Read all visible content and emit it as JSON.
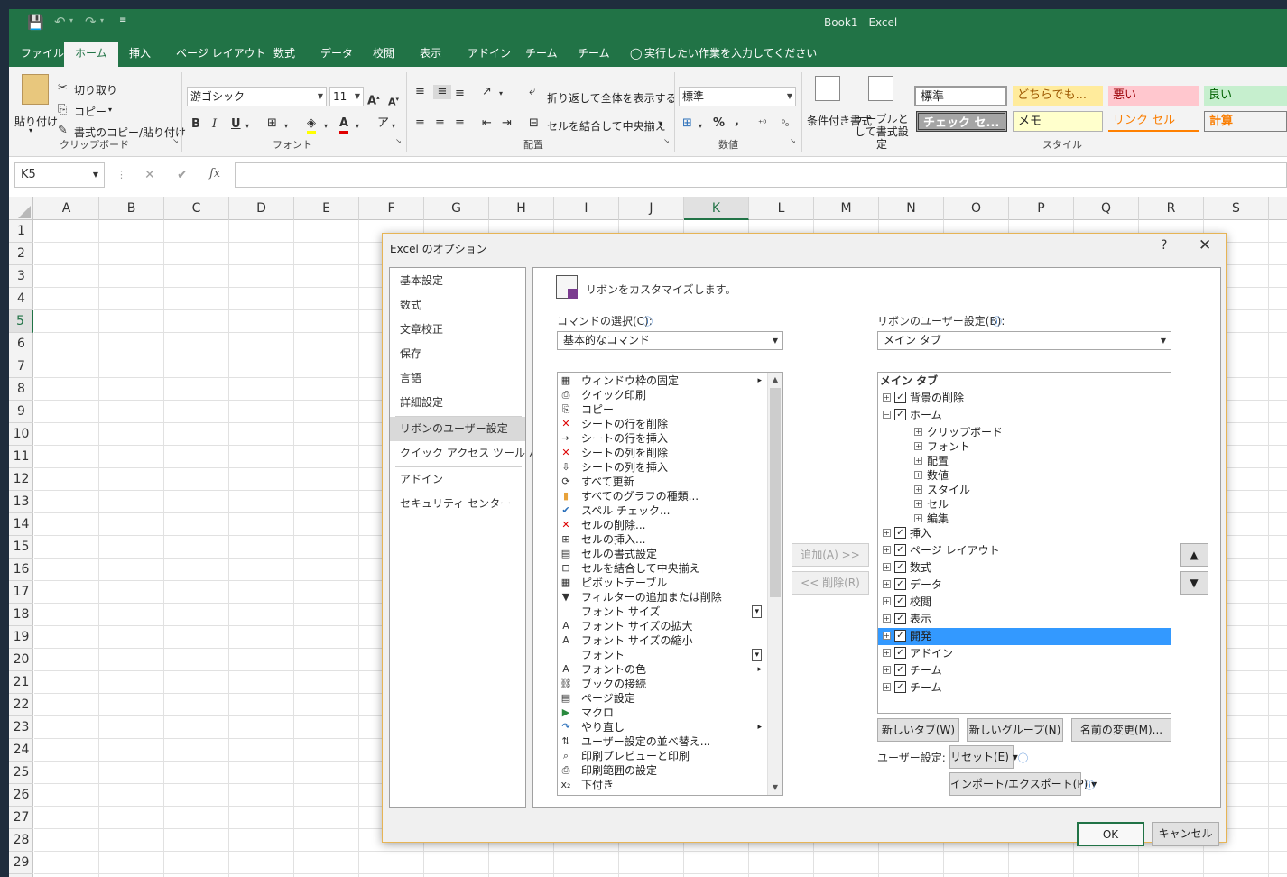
{
  "titlebar": {
    "title": "Book1  -  Excel"
  },
  "tabs": [
    "ファイル",
    "ホーム",
    "挿入",
    "ページ レイアウト",
    "数式",
    "データ",
    "校閲",
    "表示",
    "アドイン",
    "チーム",
    "チーム"
  ],
  "tell_me": "実行したい作業を入力してください",
  "ribbon": {
    "clipboard": {
      "paste": "貼り付け",
      "cut": "切り取り",
      "copy": "コピー",
      "format_painter": "書式のコピー/貼り付け",
      "label": "クリップボード"
    },
    "font": {
      "name": "游ゴシック",
      "size": "11",
      "bold": "B",
      "italic": "I",
      "underline": "U",
      "label": "フォント"
    },
    "alignment": {
      "wrap": "折り返して全体を表示する",
      "merge": "セルを結合して中央揃え",
      "label": "配置"
    },
    "number": {
      "format": "標準",
      "percent": "%",
      "comma": ",",
      "label": "数値"
    },
    "styles": {
      "cond_format": "条件付き書式",
      "format_table": "テーブルとして書式設定",
      "label": "スタイル",
      "cells": [
        "標準",
        "どちらでも...",
        "悪い",
        "良い",
        "チェック セ...",
        "メモ",
        "リンク セル",
        "計算"
      ]
    }
  },
  "formula": {
    "namebox": "K5",
    "cancel": "✕",
    "enter": "✔",
    "fx": "fx"
  },
  "columns": [
    "A",
    "B",
    "C",
    "D",
    "E",
    "F",
    "G",
    "H",
    "I",
    "J",
    "K",
    "L",
    "M",
    "N",
    "O",
    "P",
    "Q",
    "R",
    "S"
  ],
  "selected_column": "K",
  "rows": [
    "1",
    "2",
    "3",
    "4",
    "5",
    "6",
    "7",
    "8",
    "9",
    "10",
    "11",
    "12",
    "13",
    "14",
    "15",
    "16",
    "17",
    "18",
    "19",
    "20",
    "21",
    "22",
    "23",
    "24",
    "25",
    "26",
    "27",
    "28",
    "29"
  ],
  "selected_row": "5",
  "dialog": {
    "title": "Excel のオプション",
    "help": "?",
    "close": "✕",
    "nav": [
      "基本設定",
      "数式",
      "文章校正",
      "保存",
      "言語",
      "詳細設定",
      "リボンのユーザー設定",
      "クイック アクセス ツール バー",
      "アドイン",
      "セキュリティ センター"
    ],
    "nav_selected": "リボンのユーザー設定",
    "heading": "リボンをカスタマイズします。",
    "choose_label": "コマンドの選択(C):",
    "choose_value": "基本的なコマンド",
    "customize_label": "リボンのユーザー設定(B):",
    "customize_value": "メイン タブ",
    "commands": [
      {
        "label": "ウィンドウ枠の固定",
        "icon": "freeze-panes-icon",
        "extra": "▸"
      },
      {
        "label": "クイック印刷",
        "icon": "quick-print-icon",
        "extra": ""
      },
      {
        "label": "コピー",
        "icon": "copy-icon",
        "extra": ""
      },
      {
        "label": "シートの行を削除",
        "icon": "delete-rows-icon",
        "extra": ""
      },
      {
        "label": "シートの行を挿入",
        "icon": "insert-rows-icon",
        "extra": ""
      },
      {
        "label": "シートの列を削除",
        "icon": "delete-columns-icon",
        "extra": ""
      },
      {
        "label": "シートの列を挿入",
        "icon": "insert-columns-icon",
        "extra": ""
      },
      {
        "label": "すべて更新",
        "icon": "refresh-all-icon",
        "extra": ""
      },
      {
        "label": "すべてのグラフの種類...",
        "icon": "chart-types-icon",
        "extra": ""
      },
      {
        "label": "スペル チェック...",
        "icon": "spell-check-icon",
        "extra": ""
      },
      {
        "label": "セルの削除...",
        "icon": "delete-cells-icon",
        "extra": ""
      },
      {
        "label": "セルの挿入...",
        "icon": "insert-cells-icon",
        "extra": ""
      },
      {
        "label": "セルの書式設定",
        "icon": "format-cells-icon",
        "extra": ""
      },
      {
        "label": "セルを結合して中央揃え",
        "icon": "merge-center-icon",
        "extra": ""
      },
      {
        "label": "ピボットテーブル",
        "icon": "pivot-table-icon",
        "extra": ""
      },
      {
        "label": "フィルターの追加または削除",
        "icon": "filter-icon",
        "extra": ""
      },
      {
        "label": "フォント サイズ",
        "icon": "font-size-icon",
        "extra": "▾"
      },
      {
        "label": "フォント サイズの拡大",
        "icon": "font-grow-icon",
        "extra": ""
      },
      {
        "label": "フォント サイズの縮小",
        "icon": "font-shrink-icon",
        "extra": ""
      },
      {
        "label": "フォント",
        "icon": "font-icon",
        "extra": "▾"
      },
      {
        "label": "フォントの色",
        "icon": "font-color-icon",
        "extra": "▸"
      },
      {
        "label": "ブックの接続",
        "icon": "connections-icon",
        "extra": ""
      },
      {
        "label": "ページ設定",
        "icon": "page-setup-icon",
        "extra": ""
      },
      {
        "label": "マクロ",
        "icon": "macro-icon",
        "extra": ""
      },
      {
        "label": "やり直し",
        "icon": "redo-icon",
        "extra": "▸"
      },
      {
        "label": "ユーザー設定の並べ替え...",
        "icon": "sort-icon",
        "extra": ""
      },
      {
        "label": "印刷プレビューと印刷",
        "icon": "print-preview-icon",
        "extra": ""
      },
      {
        "label": "印刷範囲の設定",
        "icon": "print-area-icon",
        "extra": ""
      },
      {
        "label": "下付き",
        "icon": "subscript-icon",
        "extra": ""
      }
    ],
    "tree_header": "メイン タブ",
    "tree": [
      {
        "label": "背景の削除",
        "level": 0,
        "pm": "+",
        "checked": true,
        "selected": false
      },
      {
        "label": "ホーム",
        "level": 0,
        "pm": "−",
        "checked": true,
        "selected": false
      },
      {
        "label": "クリップボード",
        "level": 1,
        "pm": "+",
        "checked": false,
        "selected": false
      },
      {
        "label": "フォント",
        "level": 1,
        "pm": "+",
        "checked": false,
        "selected": false
      },
      {
        "label": "配置",
        "level": 1,
        "pm": "+",
        "checked": false,
        "selected": false
      },
      {
        "label": "数値",
        "level": 1,
        "pm": "+",
        "checked": false,
        "selected": false
      },
      {
        "label": "スタイル",
        "level": 1,
        "pm": "+",
        "checked": false,
        "selected": false
      },
      {
        "label": "セル",
        "level": 1,
        "pm": "+",
        "checked": false,
        "selected": false
      },
      {
        "label": "編集",
        "level": 1,
        "pm": "+",
        "checked": false,
        "selected": false
      },
      {
        "label": "挿入",
        "level": 0,
        "pm": "+",
        "checked": true,
        "selected": false
      },
      {
        "label": "ページ レイアウト",
        "level": 0,
        "pm": "+",
        "checked": true,
        "selected": false
      },
      {
        "label": "数式",
        "level": 0,
        "pm": "+",
        "checked": true,
        "selected": false
      },
      {
        "label": "データ",
        "level": 0,
        "pm": "+",
        "checked": true,
        "selected": false
      },
      {
        "label": "校閲",
        "level": 0,
        "pm": "+",
        "checked": true,
        "selected": false
      },
      {
        "label": "表示",
        "level": 0,
        "pm": "+",
        "checked": true,
        "selected": false
      },
      {
        "label": "開発",
        "level": 0,
        "pm": "+",
        "checked": true,
        "selected": true
      },
      {
        "label": "アドイン",
        "level": 0,
        "pm": "+",
        "checked": true,
        "selected": false
      },
      {
        "label": "チーム",
        "level": 0,
        "pm": "+",
        "checked": true,
        "selected": false
      },
      {
        "label": "チーム",
        "level": 0,
        "pm": "+",
        "checked": true,
        "selected": false
      }
    ],
    "add": "追加(A) >>",
    "remove": "<< 削除(R)",
    "move_up": "▲",
    "move_down": "▼",
    "new_tab": "新しいタブ(W)",
    "new_group": "新しいグループ(N)",
    "rename": "名前の変更(M)...",
    "user_settings_label": "ユーザー設定:",
    "reset": "リセット(E) ▾",
    "import_export": "インポート/エクスポート(P) ▾",
    "ok": "OK",
    "cancel": "キャンセル"
  },
  "colors": {
    "excel_green": "#217346",
    "selection_blue": "#3399ff"
  }
}
